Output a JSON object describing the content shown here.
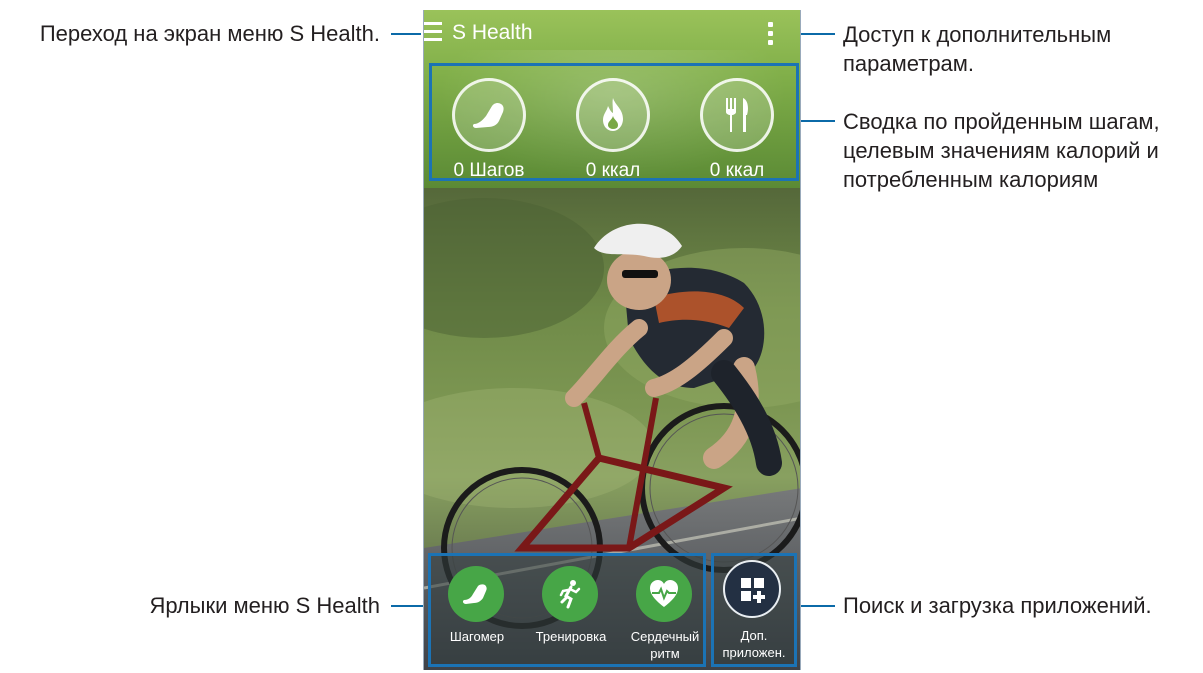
{
  "callouts": {
    "menu": "Переход на экран меню S Health.",
    "options_line1": "Доступ к дополнительным",
    "options_line2": "параметрам.",
    "summary_line1": "Сводка по пройденным шагам,",
    "summary_line2": "целевым значениям калорий и",
    "summary_line3": "потребленным калориям",
    "shortcuts": "Ярлыки меню S Health",
    "apps": "Поиск и загрузка приложений."
  },
  "app": {
    "title": "S Health",
    "menu_icon": "hamburger-icon",
    "overflow_icon": "overflow-dots-icon"
  },
  "summary": [
    {
      "icon": "shoe-icon",
      "label": "0 Шагов"
    },
    {
      "icon": "flame-icon",
      "label": "0 ккал"
    },
    {
      "icon": "fork-knife-icon",
      "label": "0 ккал"
    }
  ],
  "shortcuts": [
    {
      "icon": "shoe-icon",
      "label": "Шагомер"
    },
    {
      "icon": "runner-icon",
      "label": "Тренировка"
    },
    {
      "icon": "heart-pulse-icon",
      "label_line1": "Сердечный",
      "label_line2": "ритм"
    }
  ],
  "more_apps": {
    "icon": "add-grid-icon",
    "label_line1": "Доп.",
    "label_line2": "приложен."
  },
  "colors": {
    "callout_line": "#0b6aa8",
    "highlight_border": "#1b73b5",
    "shortcut_green": "#47a647",
    "header_green": "#82b04a"
  }
}
